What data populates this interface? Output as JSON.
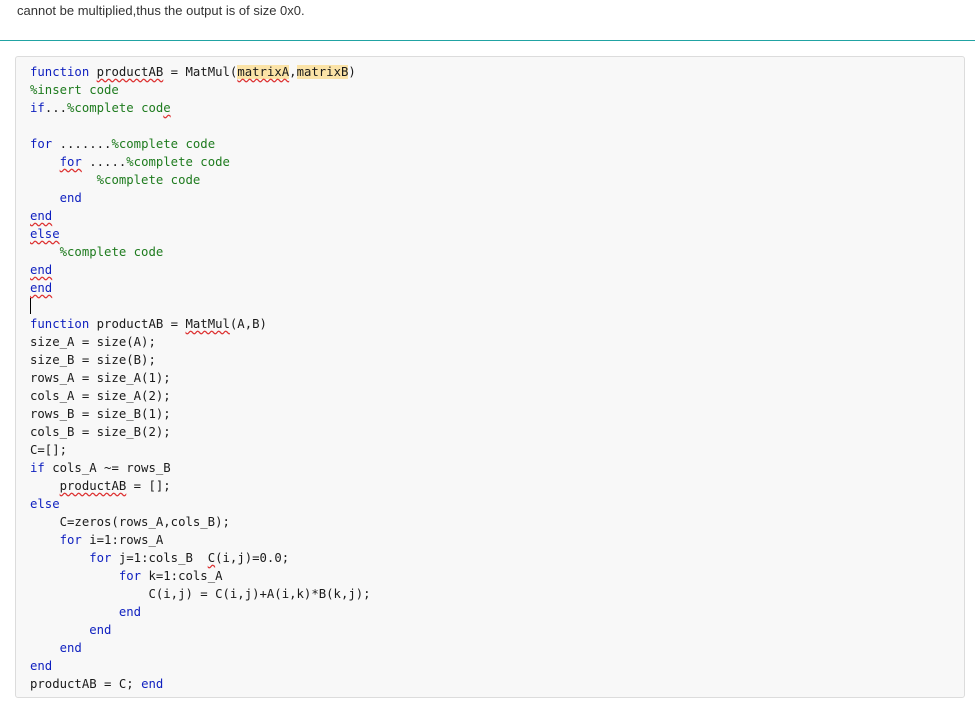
{
  "intro_text": "cannot be multiplied,thus the output is of size 0x0.",
  "colors": {
    "keyword": "#0e1fbf",
    "comment": "#1e7b1e",
    "highlight": "#fbe3a7",
    "divider": "#21a3a3"
  },
  "code_lines": [
    [
      {
        "t": "function",
        "c": "kw"
      },
      {
        "t": " "
      },
      {
        "t": "productAB",
        "c": "sq"
      },
      {
        "t": " = MatMul("
      },
      {
        "t": "matrixA",
        "c": "hl sq"
      },
      {
        "t": ","
      },
      {
        "t": "matrixB",
        "c": "hl"
      },
      {
        "t": ")"
      }
    ],
    [
      {
        "t": "%insert code",
        "c": "cm"
      }
    ],
    [
      {
        "t": "if",
        "c": "kw"
      },
      {
        "t": "..."
      },
      {
        "t": "%complete cod",
        "c": "cm"
      },
      {
        "t": "e",
        "c": "cm sq"
      }
    ],
    [
      {
        "t": ""
      }
    ],
    [
      {
        "t": "for",
        "c": "kw"
      },
      {
        "t": " ......."
      },
      {
        "t": "%complete code",
        "c": "cm"
      }
    ],
    [
      {
        "t": "    "
      },
      {
        "t": "for",
        "c": "kw sq"
      },
      {
        "t": " ....."
      },
      {
        "t": "%complete code",
        "c": "cm"
      }
    ],
    [
      {
        "t": "         "
      },
      {
        "t": "%complete code",
        "c": "cm"
      }
    ],
    [
      {
        "t": "    "
      },
      {
        "t": "end",
        "c": "kw"
      }
    ],
    [
      {
        "t": "end",
        "c": "kw sq"
      }
    ],
    [
      {
        "t": "else",
        "c": "kw sq"
      }
    ],
    [
      {
        "t": "    "
      },
      {
        "t": "%complete code",
        "c": "cm"
      }
    ],
    [
      {
        "t": "end",
        "c": "kw sq"
      }
    ],
    [
      {
        "t": "end",
        "c": "kw sq"
      }
    ],
    [
      {
        "t": "",
        "caret": true
      }
    ],
    [
      {
        "t": "function",
        "c": "kw"
      },
      {
        "t": " productAB = "
      },
      {
        "t": "MatMul",
        "c": "sq"
      },
      {
        "t": "(A,B)"
      }
    ],
    [
      {
        "t": "size_A = size(A);"
      }
    ],
    [
      {
        "t": "size_B = size(B);"
      }
    ],
    [
      {
        "t": "rows_A = size_A(1);"
      }
    ],
    [
      {
        "t": "cols_A = size_A(2);"
      }
    ],
    [
      {
        "t": "rows_B = size_B(1);"
      }
    ],
    [
      {
        "t": "cols_B = size_B(2);"
      }
    ],
    [
      {
        "t": "C=[];"
      }
    ],
    [
      {
        "t": "if",
        "c": "kw"
      },
      {
        "t": " cols_A ~= rows_B"
      }
    ],
    [
      {
        "t": "    "
      },
      {
        "t": "productAB",
        "c": "sq"
      },
      {
        "t": " = [];"
      }
    ],
    [
      {
        "t": "else",
        "c": "kw"
      }
    ],
    [
      {
        "t": "    C=zeros(rows_A,cols_B);"
      }
    ],
    [
      {
        "t": "    "
      },
      {
        "t": "for",
        "c": "kw"
      },
      {
        "t": " i=1:rows_A"
      }
    ],
    [
      {
        "t": "        "
      },
      {
        "t": "for",
        "c": "kw"
      },
      {
        "t": " j=1:cols_B  "
      },
      {
        "t": "C",
        "c": "sq"
      },
      {
        "t": "(i,j)=0.0;"
      }
    ],
    [
      {
        "t": "            "
      },
      {
        "t": "for",
        "c": "kw"
      },
      {
        "t": " k=1:cols_A"
      }
    ],
    [
      {
        "t": "                C(i,j) = C(i,j)+A(i,k)*B(k,j);"
      }
    ],
    [
      {
        "t": "            "
      },
      {
        "t": "end",
        "c": "kw"
      }
    ],
    [
      {
        "t": "        "
      },
      {
        "t": "end",
        "c": "kw"
      }
    ],
    [
      {
        "t": "    "
      },
      {
        "t": "end",
        "c": "kw"
      }
    ],
    [
      {
        "t": "end",
        "c": "kw"
      }
    ],
    [
      {
        "t": "productAB = C; "
      },
      {
        "t": "end",
        "c": "kw"
      }
    ]
  ]
}
